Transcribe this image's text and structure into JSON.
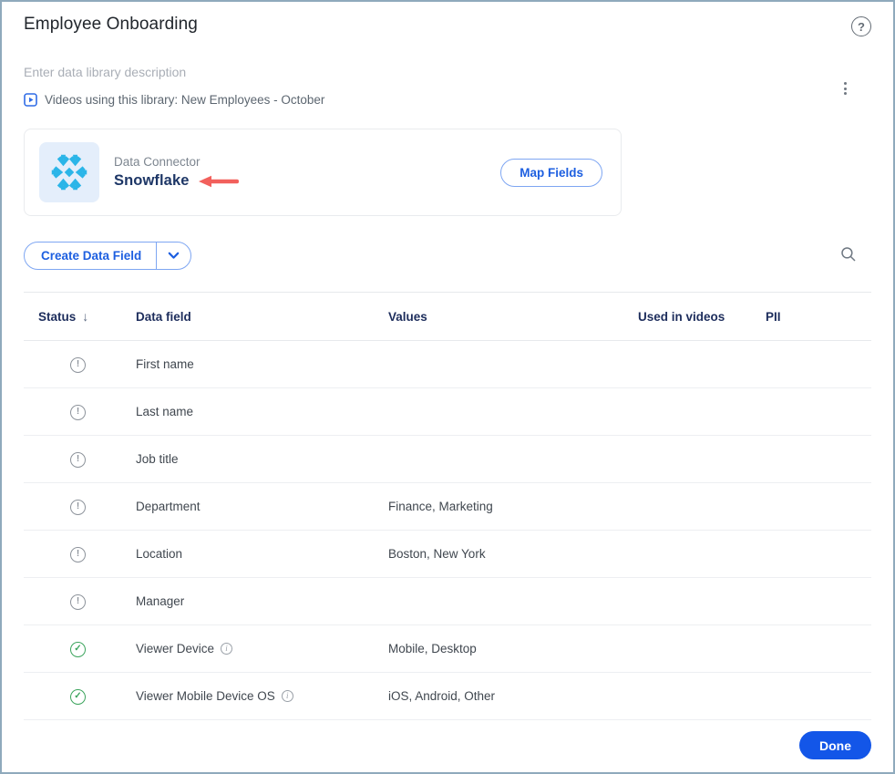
{
  "header": {
    "title": "Employee Onboarding",
    "help_label": "?",
    "description_placeholder": "Enter data library description",
    "videos_note": "Videos using this library: New Employees - October"
  },
  "connector": {
    "label": "Data Connector",
    "name": "Snowflake",
    "map_fields_label": "Map Fields"
  },
  "toolbar": {
    "create_label": "Create Data Field"
  },
  "table": {
    "columns": [
      "Status",
      "Data field",
      "Values",
      "Used in videos",
      "PII"
    ],
    "sort": {
      "column": "Status",
      "direction": "descending",
      "glyph": "↓"
    },
    "rows": [
      {
        "status": "alert",
        "field": "First name",
        "values": "",
        "info": false
      },
      {
        "status": "alert",
        "field": "Last name",
        "values": "",
        "info": false
      },
      {
        "status": "alert",
        "field": "Job title",
        "values": "",
        "info": false
      },
      {
        "status": "alert",
        "field": "Department",
        "values": "Finance, Marketing",
        "info": false
      },
      {
        "status": "alert",
        "field": "Location",
        "values": "Boston, New York",
        "info": false
      },
      {
        "status": "alert",
        "field": "Manager",
        "values": "",
        "info": false
      },
      {
        "status": "ok",
        "field": "Viewer Device",
        "values": "Mobile, Desktop",
        "info": true
      },
      {
        "status": "ok",
        "field": "Viewer Mobile Device OS",
        "values": "iOS, Android, Other",
        "info": true
      }
    ]
  },
  "footer": {
    "done_label": "Done"
  },
  "icons": {
    "help-icon": "question mark in circle",
    "kebab-menu-icon": "vertical three dots",
    "video-play-icon": "rounded square with play triangle",
    "snowflake-logo": "Snowflake brand snowflake mark",
    "annotation-arrow": "red arrow pointing left at connector name",
    "chevron-down-icon": "⌄",
    "search-icon": "magnifying glass",
    "sort-descending-icon": "↓",
    "status-alert-icon": "! in circle",
    "status-ok-icon": "✓ in circle",
    "info-icon": "i in circle"
  },
  "colors": {
    "frame_border": "#8faabc",
    "accent_blue": "#1d5fe0",
    "primary_button_blue": "#1356e8",
    "snowflake_cyan": "#2bb5e8",
    "logo_tile_bg": "#e4eefb",
    "success_green": "#3ba45c",
    "alert_gray": "#8d939b",
    "annotation_red": "#f2605c",
    "header_navy": "#1d2d5c"
  }
}
